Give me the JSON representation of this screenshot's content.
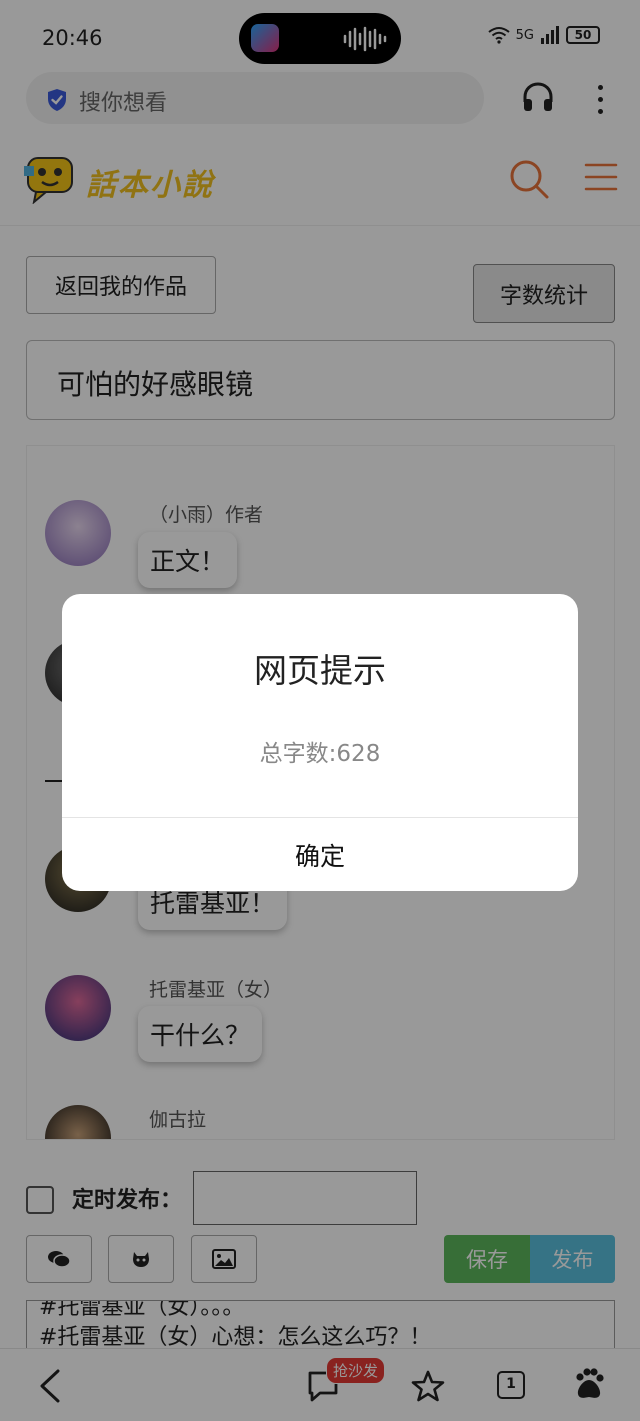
{
  "status_bar": {
    "time": "20:46",
    "network": "5G",
    "battery": "50"
  },
  "browser": {
    "search_placeholder": "搜你想看"
  },
  "site": {
    "logo_text": "話本小說"
  },
  "editor": {
    "back_label": "返回我的作品",
    "count_label": "字数统计",
    "story_title": "可怕的好感眼镜",
    "schedule_label": "定时发布：",
    "schedule_value": "",
    "save_label": "保存",
    "publish_label": "发布",
    "content_lines": [
      "#托雷基亚（女）。。。",
      "#托雷基亚（女）心想：怎么这么巧？！"
    ]
  },
  "chat": {
    "messages": [
      {
        "name": "（小雨）作者",
        "text": "正文！"
      },
      {
        "name": "",
        "text": ""
      },
      {
        "name": "",
        "text": "托雷基亚！"
      },
      {
        "name": "托雷基亚（女）",
        "text": "干什么？"
      },
      {
        "name": "伽古拉",
        "text": ""
      }
    ]
  },
  "bottom_nav": {
    "comment_badge": "抢沙发",
    "tab_count": "1"
  },
  "dialog": {
    "title": "网页提示",
    "message": "总字数:628",
    "ok_label": "确定"
  }
}
